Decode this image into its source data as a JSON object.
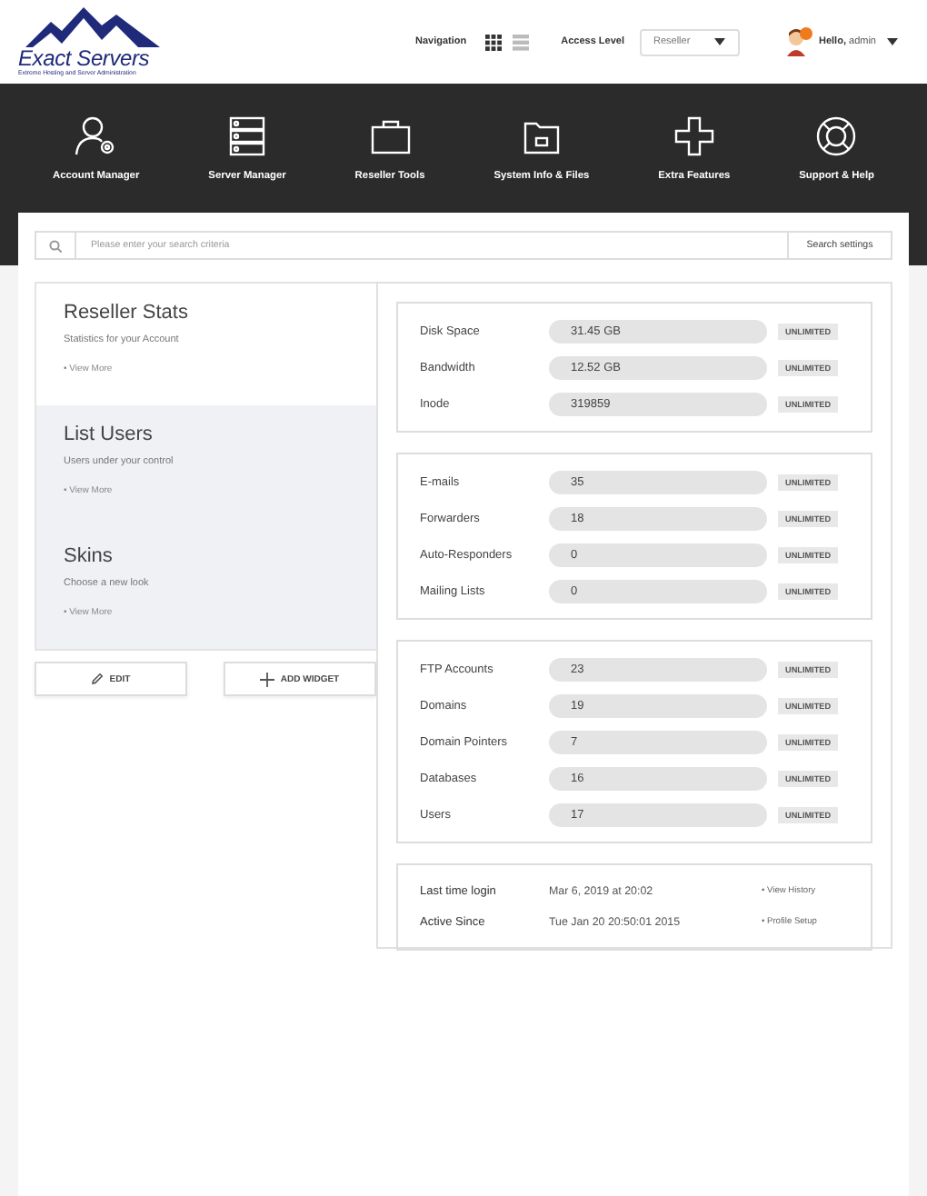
{
  "header": {
    "logo": {
      "name": "Exact Servers",
      "tagline": "Extreme Hosting and Server Administration"
    },
    "navigation": {
      "label": "Navigation",
      "views": [
        {
          "kind": "grid",
          "selected": true
        },
        {
          "kind": "list",
          "selected": false
        }
      ]
    },
    "access_level": {
      "label": "Access Level",
      "value": "Reseller"
    },
    "user": {
      "greeting": "**Hello,** admin",
      "notification": true
    }
  },
  "nav_items": [
    {
      "kind": "account",
      "label": "Account Manager"
    },
    {
      "kind": "server",
      "label": "Server Manager"
    },
    {
      "kind": "briefcase",
      "label": "Reseller Tools"
    },
    {
      "kind": "folder",
      "label": "System Info & Files"
    },
    {
      "kind": "plus",
      "label": "Extra Features"
    },
    {
      "kind": "lifebuoy",
      "label": "Support & Help"
    }
  ],
  "search": {
    "placeholder": "Please enter your search criteria",
    "button": "Search settings"
  },
  "widgets": [
    {
      "title": "Reseller Stats",
      "subtitle": "Statistics for your Account",
      "link": "• View More",
      "selected": true
    },
    {
      "title": "List Users",
      "subtitle": "Users under your control",
      "link": "• View More",
      "selected": false
    },
    {
      "title": "Skins",
      "subtitle": "Choose a new look",
      "link": "• View More",
      "selected": false
    }
  ],
  "widget_buttons": [
    {
      "kind": "edit",
      "label": "EDIT"
    },
    {
      "kind": "add",
      "label": "ADD WIDGET"
    }
  ],
  "stat_groups": [
    {
      "rows": [
        {
          "label": "Disk Space",
          "value": "31.45 GB",
          "limit": "UNLIMITED"
        },
        {
          "label": "Bandwidth",
          "value": "12.52 GB",
          "limit": "UNLIMITED"
        },
        {
          "label": "Inode",
          "value": "319859",
          "limit": "UNLIMITED"
        }
      ]
    },
    {
      "rows": [
        {
          "label": "E-mails",
          "value": "35",
          "limit": "UNLIMITED"
        },
        {
          "label": "Forwarders",
          "value": "18",
          "limit": "UNLIMITED"
        },
        {
          "label": "Auto-Responders",
          "value": "0",
          "limit": "UNLIMITED"
        },
        {
          "label": "Mailing Lists",
          "value": "0",
          "limit": "UNLIMITED"
        }
      ]
    },
    {
      "rows": [
        {
          "label": "FTP Accounts",
          "value": "23",
          "limit": "UNLIMITED"
        },
        {
          "label": "Domains",
          "value": "19",
          "limit": "UNLIMITED"
        },
        {
          "label": "Domain Pointers",
          "value": "7",
          "limit": "UNLIMITED"
        },
        {
          "label": "Databases",
          "value": "16",
          "limit": "UNLIMITED"
        },
        {
          "label": "Users",
          "value": "17",
          "limit": "UNLIMITED"
        }
      ]
    }
  ],
  "account_info": [
    {
      "label": "Last time login",
      "value": "Mar 6, 2019 at 20:02",
      "link": "• View History"
    },
    {
      "label": "Active Since",
      "value": "Tue Jan 20 20:50:01 2015",
      "link": "• Profile Setup"
    }
  ]
}
